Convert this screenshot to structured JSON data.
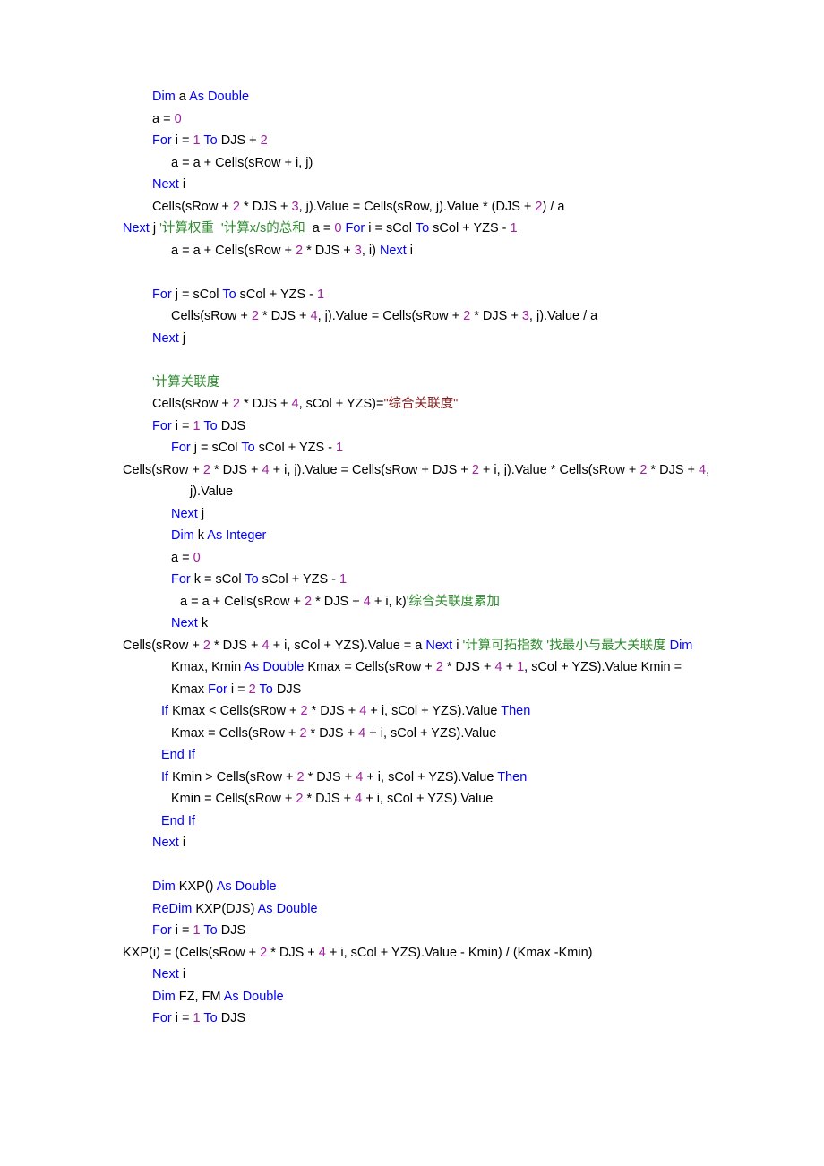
{
  "document": {
    "kind": "vba-source-listing",
    "language": "VBA",
    "background_color": "#ffffff"
  },
  "theme": {
    "keyword_color": "#0000ff",
    "number_color": "#a020a0",
    "comment_color": "#2e8b2e",
    "string_color": "#8b2020",
    "plain_color": "#000000"
  },
  "code": {
    "lines": [
      {
        "indent": "ind0",
        "tokens": [
          {
            "t": "kw",
            "s": "Dim"
          },
          {
            "t": "plain",
            "s": " a "
          },
          {
            "t": "kw",
            "s": "As Double"
          }
        ]
      },
      {
        "indent": "ind0",
        "tokens": [
          {
            "t": "plain",
            "s": "a = "
          },
          {
            "t": "num",
            "s": "0"
          }
        ]
      },
      {
        "indent": "ind0",
        "tokens": [
          {
            "t": "kw",
            "s": "For"
          },
          {
            "t": "plain",
            "s": " i = "
          },
          {
            "t": "num",
            "s": "1"
          },
          {
            "t": "plain",
            "s": " "
          },
          {
            "t": "kw",
            "s": "To"
          },
          {
            "t": "plain",
            "s": " DJS + "
          },
          {
            "t": "num",
            "s": "2"
          }
        ]
      },
      {
        "indent": "ind1",
        "tokens": [
          {
            "t": "plain",
            "s": "a = a + Cells(sRow + i, j)"
          }
        ]
      },
      {
        "indent": "ind0",
        "tokens": [
          {
            "t": "kw",
            "s": "Next"
          },
          {
            "t": "plain",
            "s": " i"
          }
        ]
      },
      {
        "indent": "ind0",
        "tokens": [
          {
            "t": "plain",
            "s": "Cells(sRow + "
          },
          {
            "t": "num",
            "s": "2"
          },
          {
            "t": "plain",
            "s": " * DJS + "
          },
          {
            "t": "num",
            "s": "3"
          },
          {
            "t": "plain",
            "s": ", j).Value = Cells(sRow, j).Value * (DJS + "
          },
          {
            "t": "num",
            "s": "2"
          },
          {
            "t": "plain",
            "s": ") / a"
          }
        ]
      },
      {
        "indent": "hang-ind0",
        "tokens": [
          {
            "t": "kw",
            "s": "Next"
          },
          {
            "t": "plain",
            "s": " j "
          },
          {
            "t": "comment",
            "s": "'计算权重  '计算x/s的总和"
          },
          {
            "t": "plain",
            "s": "  a = "
          },
          {
            "t": "num",
            "s": "0"
          },
          {
            "t": "plain",
            "s": " "
          },
          {
            "t": "kw",
            "s": "For"
          },
          {
            "t": "plain",
            "s": " i = sCol "
          },
          {
            "t": "kw",
            "s": "To"
          },
          {
            "t": "plain",
            "s": " sCol + YZS - "
          },
          {
            "t": "num",
            "s": "1"
          }
        ]
      },
      {
        "indent": "ind1",
        "tokens": [
          {
            "t": "plain",
            "s": "a = a + Cells(sRow + "
          },
          {
            "t": "num",
            "s": "2"
          },
          {
            "t": "plain",
            "s": " * DJS + "
          },
          {
            "t": "num",
            "s": "3"
          },
          {
            "t": "plain",
            "s": ", i) "
          },
          {
            "t": "kw",
            "s": "Next"
          },
          {
            "t": "plain",
            "s": " i"
          }
        ]
      },
      {
        "indent": "blank",
        "tokens": []
      },
      {
        "indent": "ind0",
        "tokens": [
          {
            "t": "kw",
            "s": "For"
          },
          {
            "t": "plain",
            "s": " j = sCol "
          },
          {
            "t": "kw",
            "s": "To"
          },
          {
            "t": "plain",
            "s": " sCol + YZS - "
          },
          {
            "t": "num",
            "s": "1"
          }
        ]
      },
      {
        "indent": "ind1",
        "tokens": [
          {
            "t": "plain",
            "s": "Cells(sRow + "
          },
          {
            "t": "num",
            "s": "2"
          },
          {
            "t": "plain",
            "s": " * DJS + "
          },
          {
            "t": "num",
            "s": "4"
          },
          {
            "t": "plain",
            "s": ", j).Value = Cells(sRow + "
          },
          {
            "t": "num",
            "s": "2"
          },
          {
            "t": "plain",
            "s": " * DJS + "
          },
          {
            "t": "num",
            "s": "3"
          },
          {
            "t": "plain",
            "s": ", j).Value / a"
          }
        ]
      },
      {
        "indent": "ind0",
        "tokens": [
          {
            "t": "kw",
            "s": "Next"
          },
          {
            "t": "plain",
            "s": " j"
          }
        ]
      },
      {
        "indent": "blank",
        "tokens": []
      },
      {
        "indent": "ind0",
        "tokens": [
          {
            "t": "comment",
            "s": "'计算关联度"
          }
        ]
      },
      {
        "indent": "ind0",
        "tokens": [
          {
            "t": "plain",
            "s": "Cells(sRow + "
          },
          {
            "t": "num",
            "s": "2"
          },
          {
            "t": "plain",
            "s": " * DJS + "
          },
          {
            "t": "num",
            "s": "4"
          },
          {
            "t": "plain",
            "s": ", sCol + YZS)="
          },
          {
            "t": "string",
            "s": "\"综合关联度\""
          }
        ]
      },
      {
        "indent": "ind0",
        "tokens": [
          {
            "t": "kw",
            "s": "For"
          },
          {
            "t": "plain",
            "s": " i = "
          },
          {
            "t": "num",
            "s": "1"
          },
          {
            "t": "plain",
            "s": " "
          },
          {
            "t": "kw",
            "s": "To"
          },
          {
            "t": "plain",
            "s": " DJS"
          }
        ]
      },
      {
        "indent": "ind1",
        "tokens": [
          {
            "t": "kw",
            "s": "For"
          },
          {
            "t": "plain",
            "s": " j = sCol "
          },
          {
            "t": "kw",
            "s": "To"
          },
          {
            "t": "plain",
            "s": " sCol + YZS - "
          },
          {
            "t": "num",
            "s": "1"
          }
        ]
      },
      {
        "indent": "hang-ind2",
        "tokens": [
          {
            "t": "plain",
            "s": "Cells(sRow + "
          },
          {
            "t": "num",
            "s": "2"
          },
          {
            "t": "plain",
            "s": " * DJS + "
          },
          {
            "t": "num",
            "s": "4"
          },
          {
            "t": "plain",
            "s": " + i, j).Value = Cells(sRow + DJS + "
          },
          {
            "t": "num",
            "s": "2"
          },
          {
            "t": "plain",
            "s": " + i, j).Value * Cells(sRow + "
          },
          {
            "t": "num",
            "s": "2"
          },
          {
            "t": "plain",
            "s": " * DJS + "
          },
          {
            "t": "num",
            "s": "4"
          },
          {
            "t": "plain",
            "s": ", j).Value"
          }
        ]
      },
      {
        "indent": "ind1",
        "tokens": [
          {
            "t": "kw",
            "s": "Next"
          },
          {
            "t": "plain",
            "s": " j"
          }
        ]
      },
      {
        "indent": "ind1",
        "tokens": [
          {
            "t": "kw",
            "s": "Dim"
          },
          {
            "t": "plain",
            "s": " k "
          },
          {
            "t": "kw",
            "s": "As Integer"
          }
        ]
      },
      {
        "indent": "ind1",
        "tokens": [
          {
            "t": "plain",
            "s": "a = "
          },
          {
            "t": "num",
            "s": "0"
          }
        ]
      },
      {
        "indent": "ind1",
        "tokens": [
          {
            "t": "kw",
            "s": "For"
          },
          {
            "t": "plain",
            "s": " k = sCol "
          },
          {
            "t": "kw",
            "s": "To"
          },
          {
            "t": "plain",
            "s": " sCol + YZS - "
          },
          {
            "t": "num",
            "s": "1"
          }
        ]
      },
      {
        "indent": "ind15",
        "tokens": [
          {
            "t": "plain",
            "s": "a = a + Cells(sRow + "
          },
          {
            "t": "num",
            "s": "2"
          },
          {
            "t": "plain",
            "s": " * DJS + "
          },
          {
            "t": "num",
            "s": "4"
          },
          {
            "t": "plain",
            "s": " + i, k)"
          },
          {
            "t": "comment",
            "s": "'综合关联度累加"
          }
        ]
      },
      {
        "indent": "ind1",
        "tokens": [
          {
            "t": "kw",
            "s": "Next"
          },
          {
            "t": "plain",
            "s": " k"
          }
        ]
      },
      {
        "indent": "hang-ind1",
        "tokens": [
          {
            "t": "plain",
            "s": "Cells(sRow + "
          },
          {
            "t": "num",
            "s": "2"
          },
          {
            "t": "plain",
            "s": " * DJS + "
          },
          {
            "t": "num",
            "s": "4"
          },
          {
            "t": "plain",
            "s": " + i, sCol + YZS).Value = a "
          },
          {
            "t": "kw",
            "s": "Next"
          },
          {
            "t": "plain",
            "s": " i "
          },
          {
            "t": "comment",
            "s": "'计算可拓指数 '找最小与最大关联度"
          },
          {
            "t": "plain",
            "s": " "
          },
          {
            "t": "kw",
            "s": "Dim"
          },
          {
            "t": "plain",
            "s": " Kmax, Kmin "
          },
          {
            "t": "kw",
            "s": "As Double"
          },
          {
            "t": "plain",
            "s": " Kmax = Cells(sRow + "
          },
          {
            "t": "num",
            "s": "2"
          },
          {
            "t": "plain",
            "s": " * DJS + "
          },
          {
            "t": "num",
            "s": "4"
          },
          {
            "t": "plain",
            "s": " + "
          },
          {
            "t": "num",
            "s": "1"
          },
          {
            "t": "plain",
            "s": ", sCol + YZS).Value Kmin = Kmax "
          },
          {
            "t": "kw",
            "s": "For"
          },
          {
            "t": "plain",
            "s": " i = "
          },
          {
            "t": "num",
            "s": "2"
          },
          {
            "t": "plain",
            "s": " "
          },
          {
            "t": "kw",
            "s": "To"
          },
          {
            "t": "plain",
            "s": " DJS"
          }
        ]
      },
      {
        "indent": "ind05",
        "tokens": [
          {
            "t": "kw",
            "s": "If"
          },
          {
            "t": "plain",
            "s": " Kmax < Cells(sRow + "
          },
          {
            "t": "num",
            "s": "2"
          },
          {
            "t": "plain",
            "s": " * DJS + "
          },
          {
            "t": "num",
            "s": "4"
          },
          {
            "t": "plain",
            "s": " + i, sCol + YZS).Value "
          },
          {
            "t": "kw",
            "s": "Then"
          }
        ]
      },
      {
        "indent": "ind1",
        "tokens": [
          {
            "t": "plain",
            "s": "Kmax = Cells(sRow + "
          },
          {
            "t": "num",
            "s": "2"
          },
          {
            "t": "plain",
            "s": " * DJS + "
          },
          {
            "t": "num",
            "s": "4"
          },
          {
            "t": "plain",
            "s": " + i, sCol + YZS).Value"
          }
        ]
      },
      {
        "indent": "ind05",
        "tokens": [
          {
            "t": "kw",
            "s": "End If"
          }
        ]
      },
      {
        "indent": "ind05",
        "tokens": [
          {
            "t": "kw",
            "s": "If"
          },
          {
            "t": "plain",
            "s": " Kmin > Cells(sRow + "
          },
          {
            "t": "num",
            "s": "2"
          },
          {
            "t": "plain",
            "s": " * DJS + "
          },
          {
            "t": "num",
            "s": "4"
          },
          {
            "t": "plain",
            "s": " + i, sCol + YZS).Value "
          },
          {
            "t": "kw",
            "s": "Then"
          }
        ]
      },
      {
        "indent": "ind1",
        "tokens": [
          {
            "t": "plain",
            "s": "Kmin = Cells(sRow + "
          },
          {
            "t": "num",
            "s": "2"
          },
          {
            "t": "plain",
            "s": " * DJS + "
          },
          {
            "t": "num",
            "s": "4"
          },
          {
            "t": "plain",
            "s": " + i, sCol + YZS).Value"
          }
        ]
      },
      {
        "indent": "ind05",
        "tokens": [
          {
            "t": "kw",
            "s": "End If"
          }
        ]
      },
      {
        "indent": "ind0",
        "tokens": [
          {
            "t": "kw",
            "s": "Next"
          },
          {
            "t": "plain",
            "s": " i"
          }
        ]
      },
      {
        "indent": "blank",
        "tokens": []
      },
      {
        "indent": "ind0",
        "tokens": [
          {
            "t": "kw",
            "s": "Dim"
          },
          {
            "t": "plain",
            "s": " KXP() "
          },
          {
            "t": "kw",
            "s": "As Double"
          }
        ]
      },
      {
        "indent": "ind0",
        "tokens": [
          {
            "t": "kw",
            "s": "ReDim"
          },
          {
            "t": "plain",
            "s": " KXP(DJS) "
          },
          {
            "t": "kw",
            "s": "As Double"
          }
        ]
      },
      {
        "indent": "ind0",
        "tokens": [
          {
            "t": "kw",
            "s": "For"
          },
          {
            "t": "plain",
            "s": " i = "
          },
          {
            "t": "num",
            "s": "1"
          },
          {
            "t": "plain",
            "s": " "
          },
          {
            "t": "kw",
            "s": "To"
          },
          {
            "t": "plain",
            "s": " DJS"
          }
        ]
      },
      {
        "indent": "hang-ind1",
        "tokens": [
          {
            "t": "plain",
            "s": "KXP(i) = (Cells(sRow + "
          },
          {
            "t": "num",
            "s": "2"
          },
          {
            "t": "plain",
            "s": " * DJS + "
          },
          {
            "t": "num",
            "s": "4"
          },
          {
            "t": "plain",
            "s": " + i, sCol + YZS).Value - Kmin) / (Kmax -Kmin)"
          }
        ]
      },
      {
        "indent": "ind0",
        "tokens": [
          {
            "t": "kw",
            "s": "Next"
          },
          {
            "t": "plain",
            "s": " i"
          }
        ]
      },
      {
        "indent": "ind0",
        "tokens": [
          {
            "t": "kw",
            "s": "Dim"
          },
          {
            "t": "plain",
            "s": " FZ, FM "
          },
          {
            "t": "kw",
            "s": "As Double"
          }
        ]
      },
      {
        "indent": "ind0",
        "tokens": [
          {
            "t": "kw",
            "s": "For"
          },
          {
            "t": "plain",
            "s": " i = "
          },
          {
            "t": "num",
            "s": "1"
          },
          {
            "t": "plain",
            "s": " "
          },
          {
            "t": "kw",
            "s": "To"
          },
          {
            "t": "plain",
            "s": " DJS"
          }
        ]
      }
    ]
  }
}
